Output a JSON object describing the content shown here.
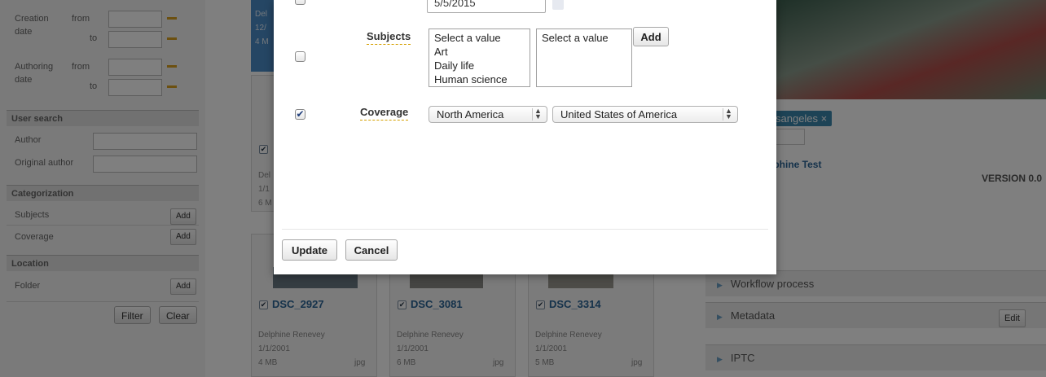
{
  "filters": {
    "creation_label": "Creation date",
    "creation_line1": "Creation",
    "creation_line2": "date",
    "authoring_line1": "Authoring",
    "authoring_line2": "date",
    "from": "from",
    "to": "to",
    "user_search": {
      "title": "User search",
      "author": "Author",
      "original_author": "Original author"
    },
    "categorization": {
      "title": "Categorization",
      "subjects": "Subjects",
      "coverage": "Coverage",
      "add": "Add"
    },
    "location": {
      "title": "Location",
      "folder": "Folder",
      "add": "Add"
    },
    "filter_button": "Filter",
    "clear_button": "Clear"
  },
  "cards": [
    {
      "title": "DSC_2927",
      "author": "Delphine Renevey",
      "date": "1/1/2001",
      "size": "4 MB",
      "ext": "jpg"
    },
    {
      "title": "DSC_3081",
      "author": "Delphine Renevey",
      "date": "1/1/2001",
      "size": "6 MB",
      "ext": "jpg"
    },
    {
      "title": "DSC_3314",
      "author": "Delphine Renevey",
      "date": "1/1/2001",
      "size": "5 MB",
      "ext": "jpg"
    }
  ],
  "top_card": {
    "l1": "Del",
    "l2": "12/",
    "l3": "4 M"
  },
  "mid_card": {
    "l1": "Del",
    "l2": "1/1",
    "l3": "6 M"
  },
  "detail": {
    "tag": "sangeles ×",
    "author_partial": "lphine Test",
    "version": "VERSION 0.0",
    "accordion": [
      {
        "label": "Workflow process"
      },
      {
        "label": "Metadata",
        "button": "Edit"
      },
      {
        "label": "IPTC"
      }
    ]
  },
  "modal": {
    "date_value": "5/5/2015",
    "subjects_label": "Subjects",
    "subjects_options": [
      "Select a value",
      "Art",
      "Daily life",
      "Human science"
    ],
    "subjects_second": "Select a value",
    "add_button": "Add",
    "coverage_label": "Coverage",
    "coverage_region": "North America",
    "coverage_country": "United States of America",
    "update_button": "Update",
    "cancel_button": "Cancel",
    "subjects_checked": false,
    "coverage_checked": true,
    "check_glyph": "✔"
  }
}
